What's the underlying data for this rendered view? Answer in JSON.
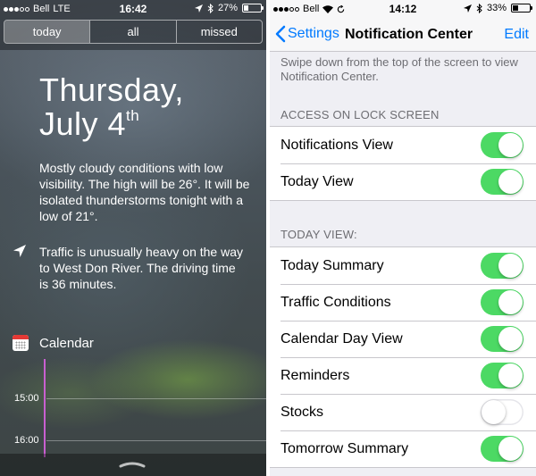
{
  "left": {
    "status_bar": {
      "carrier": "Bell",
      "network": "LTE",
      "time": "16:42",
      "battery": "27%",
      "battery_level": 0.27
    },
    "tabs": [
      {
        "label": "today",
        "selected": true
      },
      {
        "label": "all",
        "selected": false
      },
      {
        "label": "missed",
        "selected": false
      }
    ],
    "date_line1": "Thursday,",
    "date_line2": "July 4",
    "date_suffix": "th",
    "weather_summary": "Mostly cloudy conditions with low visibility. The high will be 26°. It will be isolated thunderstorms tonight with a low of 21°.",
    "traffic_summary": "Traffic is unusually heavy on the way to West Don River. The driving time is 36 minutes.",
    "calendar": {
      "label": "Calendar",
      "hours": [
        "15:00",
        "16:00"
      ],
      "now_line_color": "#c95fd0"
    }
  },
  "right": {
    "status_bar": {
      "carrier": "Bell",
      "time": "14:12",
      "battery": "33%",
      "battery_level": 0.33
    },
    "nav": {
      "back_label": "Settings",
      "title": "Notification Center",
      "edit_label": "Edit"
    },
    "hint": "Swipe down from the top of the screen to view Notification Center.",
    "lock_section": {
      "header": "ACCESS ON LOCK SCREEN",
      "rows": [
        {
          "label": "Notifications View",
          "on": true
        },
        {
          "label": "Today View",
          "on": true
        }
      ]
    },
    "today_section": {
      "header": "TODAY VIEW:",
      "rows": [
        {
          "label": "Today Summary",
          "on": true
        },
        {
          "label": "Traffic Conditions",
          "on": true
        },
        {
          "label": "Calendar Day View",
          "on": true
        },
        {
          "label": "Reminders",
          "on": true
        },
        {
          "label": "Stocks",
          "on": false
        },
        {
          "label": "Tomorrow Summary",
          "on": true
        }
      ]
    },
    "colors": {
      "accent": "#007aff",
      "toggle_on": "#4cd964"
    }
  }
}
